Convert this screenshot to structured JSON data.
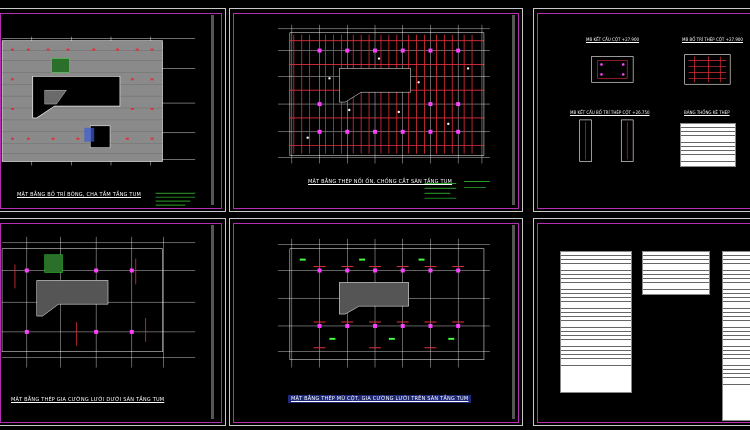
{
  "sheets": {
    "s1": {
      "caption": "MẶT BẰNG BỐ TRÍ BÓNG, CHA TẦM TẦNG TUM"
    },
    "s2": {
      "caption": "MẶT BẰNG THÉP NỐI ỐN, CHỐNG CẮT SÀN TẦNG TUM"
    },
    "s3": {
      "labels": [
        "MB KẾT CẤU CỘT +27.900",
        "MB BỐ TRÍ THÉP CỘT +27.900",
        "MB KẾT CẤU BỐ TRÍ THÉP CỘT +26.750",
        "BẢNG THỐNG KÊ THÉP"
      ]
    },
    "s4": {
      "caption": "MẶT BẰNG THÉP GIA CƯỜNG LƯỚI DƯỚI SÀN TẦNG TUM"
    },
    "s5": {
      "caption": "MẶT BẰNG THÉP MŨ CỘT, GIA CƯỜNG LƯỚI TRÊN SÀN TẦNG TUM"
    }
  },
  "colors": {
    "background": "#000000",
    "frame": "#b22fb2",
    "sheet_border": "#c8c8c8",
    "rebar": "#e0303a",
    "grid": "#dcdcdc",
    "column": "#ff40ff",
    "annotation": "#40ff40",
    "highlight": "#1e2a78"
  }
}
